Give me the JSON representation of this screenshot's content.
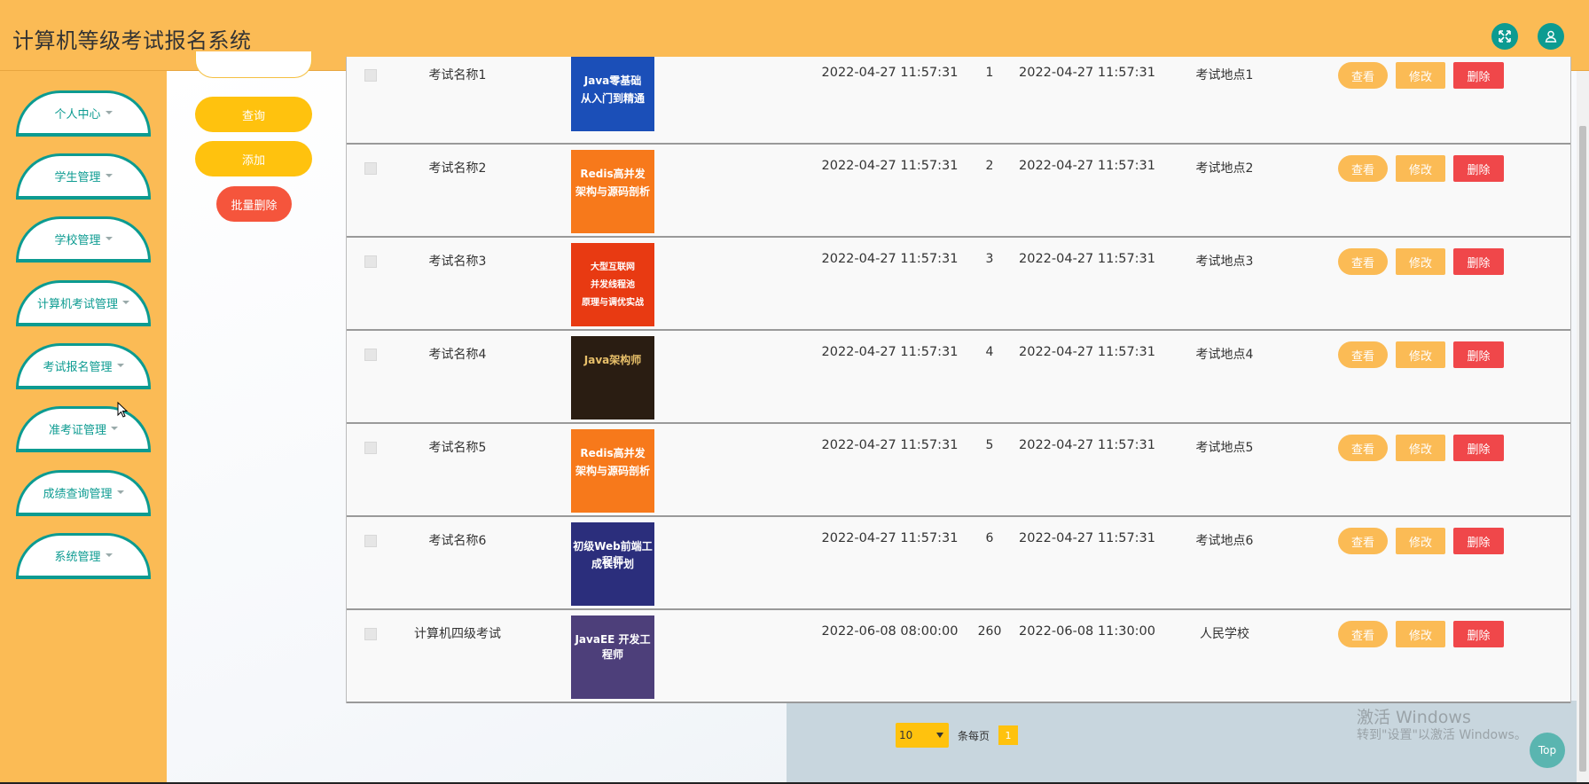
{
  "app": {
    "title": "计算机等级考试报名系统"
  },
  "header": {
    "fullscreen_icon": "expand-icon",
    "user_icon": "user-icon"
  },
  "sidebar": {
    "items": [
      {
        "label": "个人中心"
      },
      {
        "label": "学生管理"
      },
      {
        "label": "学校管理"
      },
      {
        "label": "计算机考试管理"
      },
      {
        "label": "考试报名管理"
      },
      {
        "label": "准考证管理"
      },
      {
        "label": "成绩查询管理"
      },
      {
        "label": "系统管理"
      }
    ]
  },
  "actions": {
    "query": "查询",
    "add": "添加",
    "batch_delete": "批量删除"
  },
  "table": {
    "rows": [
      {
        "name": "考试名称1",
        "num": "1",
        "start": "2022-04-27 11:57:31",
        "end": "2022-04-27 11:57:31",
        "location": "考试地点1",
        "thumb_text": "Java零基础\n从入门到精通",
        "thumb_color": "#1b4fb8"
      },
      {
        "name": "考试名称2",
        "num": "2",
        "start": "2022-04-27 11:57:31",
        "end": "2022-04-27 11:57:31",
        "location": "考试地点2",
        "thumb_text": "Redis高并发\n架构与源码剖析",
        "thumb_color": "#f7791b"
      },
      {
        "name": "考试名称3",
        "num": "3",
        "start": "2022-04-27 11:57:31",
        "end": "2022-04-27 11:57:31",
        "location": "考试地点3",
        "thumb_text": "大型互联网\n并发线程池\n原理与调优实战",
        "thumb_color": "#e83a12"
      },
      {
        "name": "考试名称4",
        "num": "4",
        "start": "2022-04-27 11:57:31",
        "end": "2022-04-27 11:57:31",
        "location": "考试地点4",
        "thumb_text": "Java架构师",
        "thumb_color": "#2a1d12"
      },
      {
        "name": "考试名称5",
        "num": "5",
        "start": "2022-04-27 11:57:31",
        "end": "2022-04-27 11:57:31",
        "location": "考试地点5",
        "thumb_text": "Redis高并发\n架构与源码剖析",
        "thumb_color": "#f7791b"
      },
      {
        "name": "考试名称6",
        "num": "6",
        "start": "2022-04-27 11:57:31",
        "end": "2022-04-27 11:57:31",
        "location": "考试地点6",
        "thumb_text": "初级Web前端工程师\n成长计划",
        "thumb_color": "#2b2e7c"
      },
      {
        "name": "计算机四级考试",
        "num": "260",
        "start": "2022-06-08 08:00:00",
        "end": "2022-06-08 11:30:00",
        "location": "人民学校",
        "thumb_text": "JavaEE 开发工程师",
        "thumb_color": "#4d3f7a"
      }
    ],
    "view_label": "查看",
    "edit_label": "修改",
    "delete_label": "删除"
  },
  "pagination": {
    "page_size": "10",
    "per_page_label": "条每页",
    "current_page": "1"
  },
  "watermark": {
    "line1": "激活 Windows",
    "line2": "转到\"设置\"以激活 Windows。"
  },
  "top_button": "Top",
  "colors": {
    "primary": "#fbbb55",
    "accent": "#0c9b91",
    "danger": "#f0474a",
    "query": "#ffc20e"
  }
}
